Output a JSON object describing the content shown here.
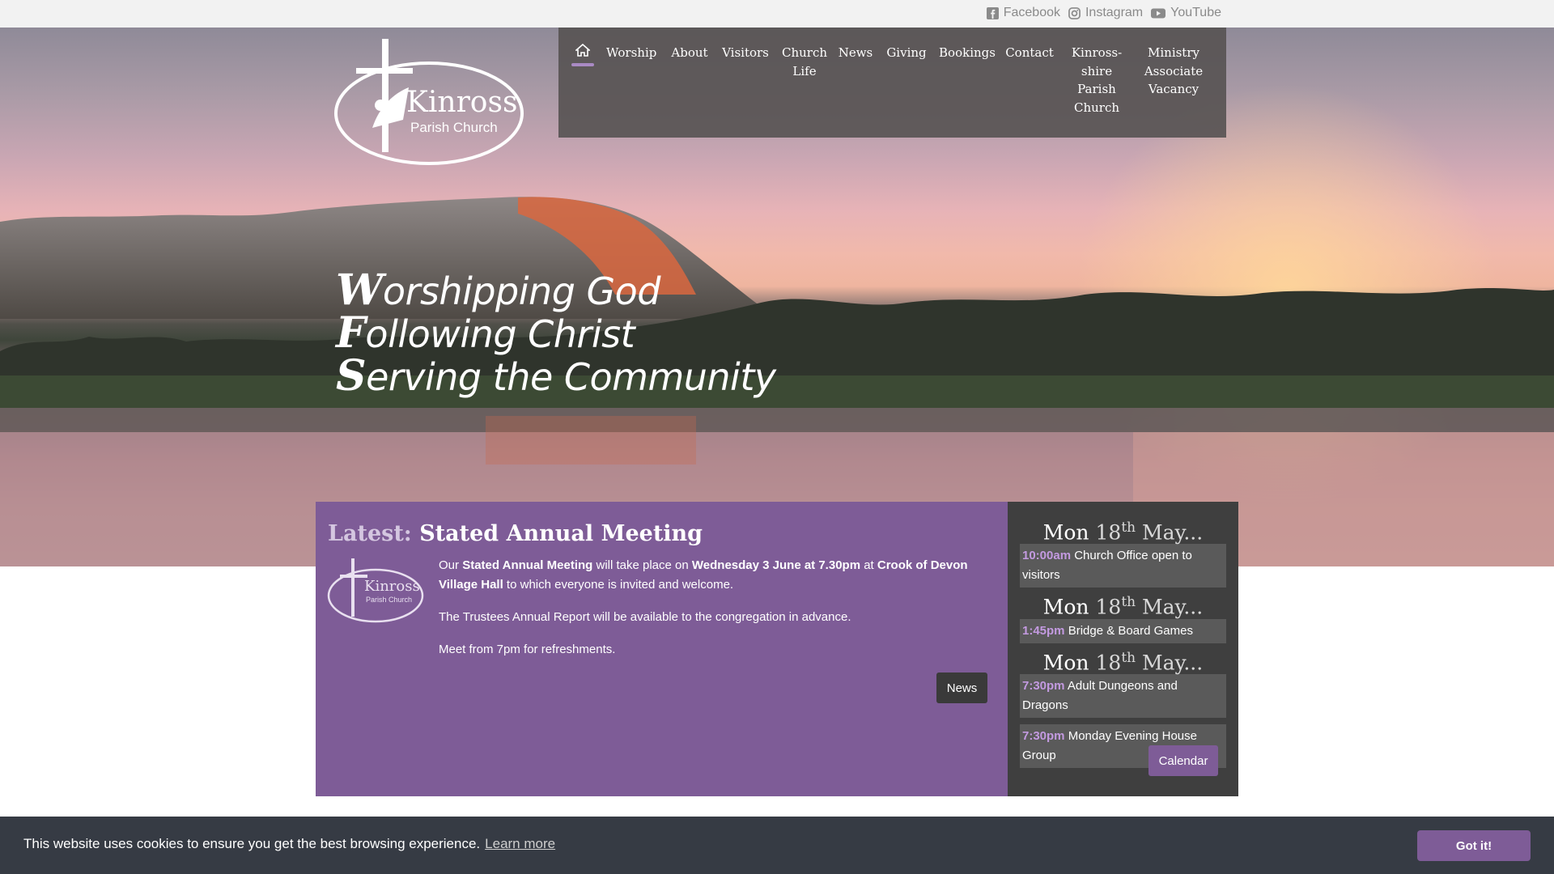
{
  "social": {
    "links": [
      {
        "label": "Facebook",
        "icon": "facebook-icon"
      },
      {
        "label": "Instagram",
        "icon": "instagram-icon"
      },
      {
        "label": "YouTube",
        "icon": "youtube-icon"
      }
    ]
  },
  "logo": {
    "title": "Kinross",
    "subtitle": "Parish Church"
  },
  "nav": {
    "home_icon": "home-icon",
    "items": [
      "Worship",
      "About",
      "Visitors",
      "Church Life",
      "News",
      "Giving",
      "Bookings",
      "Contact",
      "Kinross-shire Parish Church",
      "Ministry Associate Vacancy"
    ]
  },
  "motto": {
    "line1": {
      "cap": "W",
      "rest": "orshipping God"
    },
    "line2": {
      "cap": "F",
      "rest": "ollowing Christ"
    },
    "line3": {
      "cap": "S",
      "rest": "erving the Community"
    }
  },
  "news": {
    "latest_label": "Latest:",
    "title": "Stated Annual Meeting",
    "p1_a": "Our ",
    "p1_b": "Stated Annual Meeting",
    "p1_c": " will take place on ",
    "p1_d": "Wednesday 3 June at 7.30pm",
    "p1_e": " at ",
    "p1_f": "Crook of Devon Village Hall",
    "p1_g": " to which everyone is invited and welcome.",
    "p2": "The Trustees Annual Report will be available to the congregation in advance.",
    "p3": "Meet from 7pm for refreshments.",
    "button": "News"
  },
  "calendar": {
    "days": [
      {
        "dow": "Mon",
        "num": "18",
        "suffix": "th",
        "month": "May...",
        "events": [
          {
            "time": "10:00am",
            "title": "Church Office open to visitors"
          }
        ]
      },
      {
        "dow": "Mon",
        "num": "18",
        "suffix": "th",
        "month": "May...",
        "events": [
          {
            "time": "1:45pm",
            "title": "Bridge & Board Games"
          }
        ]
      },
      {
        "dow": "Mon",
        "num": "18",
        "suffix": "th",
        "month": "May...",
        "events": [
          {
            "time": "7:30pm",
            "title": "Adult Dungeons and Dragons"
          },
          {
            "time": "7:30pm",
            "title": "Monday Evening House Group"
          }
        ]
      }
    ],
    "button": "Calendar"
  },
  "cookie": {
    "text": "This website uses cookies to ensure you get the best browsing experience.",
    "link": "Learn more",
    "button": "Got it!"
  },
  "colors": {
    "accent": "#7e5c97",
    "calendar_bg": "#3f3f3f",
    "nav_bg": "#585454",
    "cookie_bg": "#363b44",
    "event_time": "#c39ae0"
  }
}
